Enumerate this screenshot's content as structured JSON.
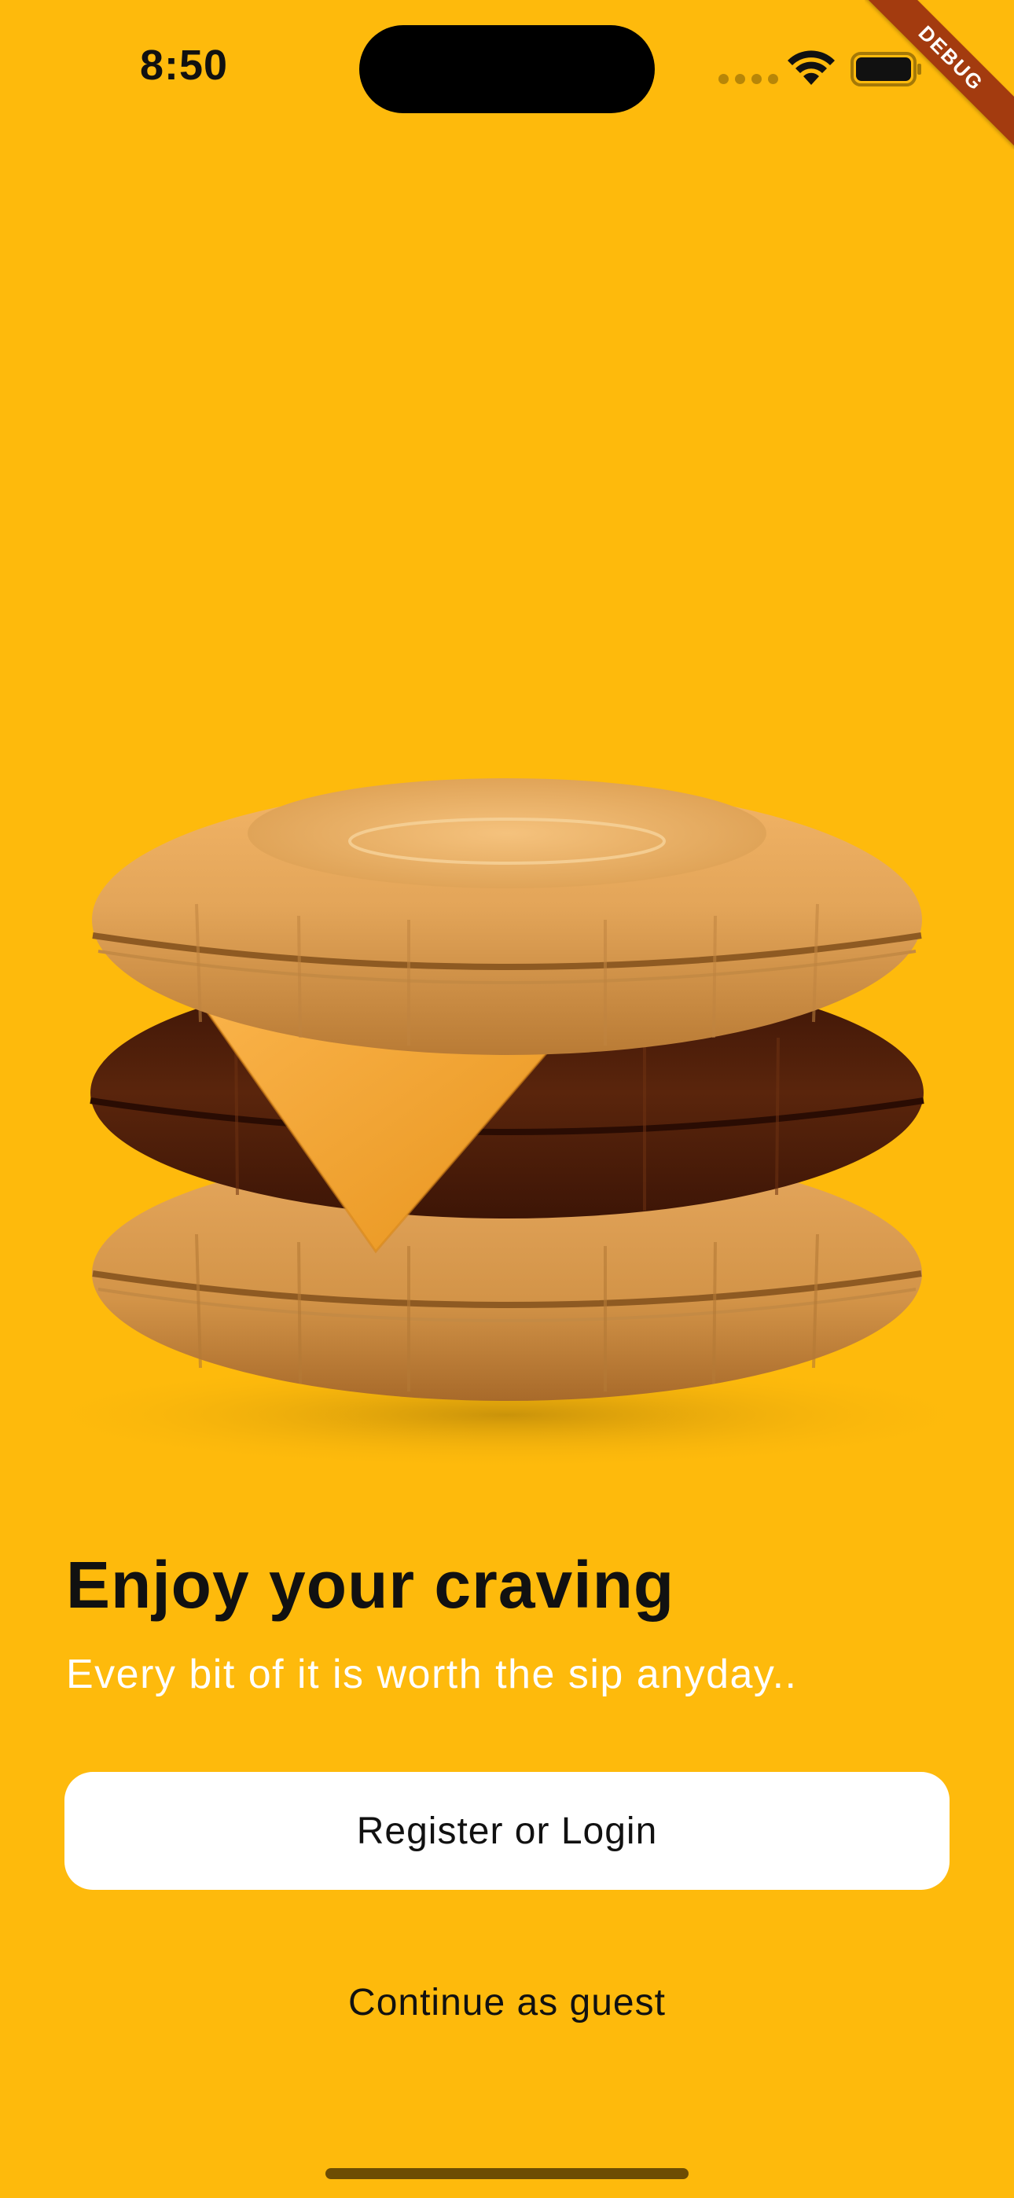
{
  "status_bar": {
    "time": "8:50",
    "wifi_icon": "wifi-icon",
    "battery_icon": "battery-icon"
  },
  "debug_banner": "DEBUG",
  "hero": {
    "icon": "burger-float-illustration"
  },
  "content": {
    "headline": "Enjoy your craving",
    "subline": "Every bit of it is worth the sip anyday.."
  },
  "actions": {
    "primary_label": "Register or Login",
    "secondary_label": "Continue as guest"
  },
  "colors": {
    "background": "#FEBA0C",
    "button": "#FFFFFF",
    "ribbon": "#A33B0F"
  }
}
